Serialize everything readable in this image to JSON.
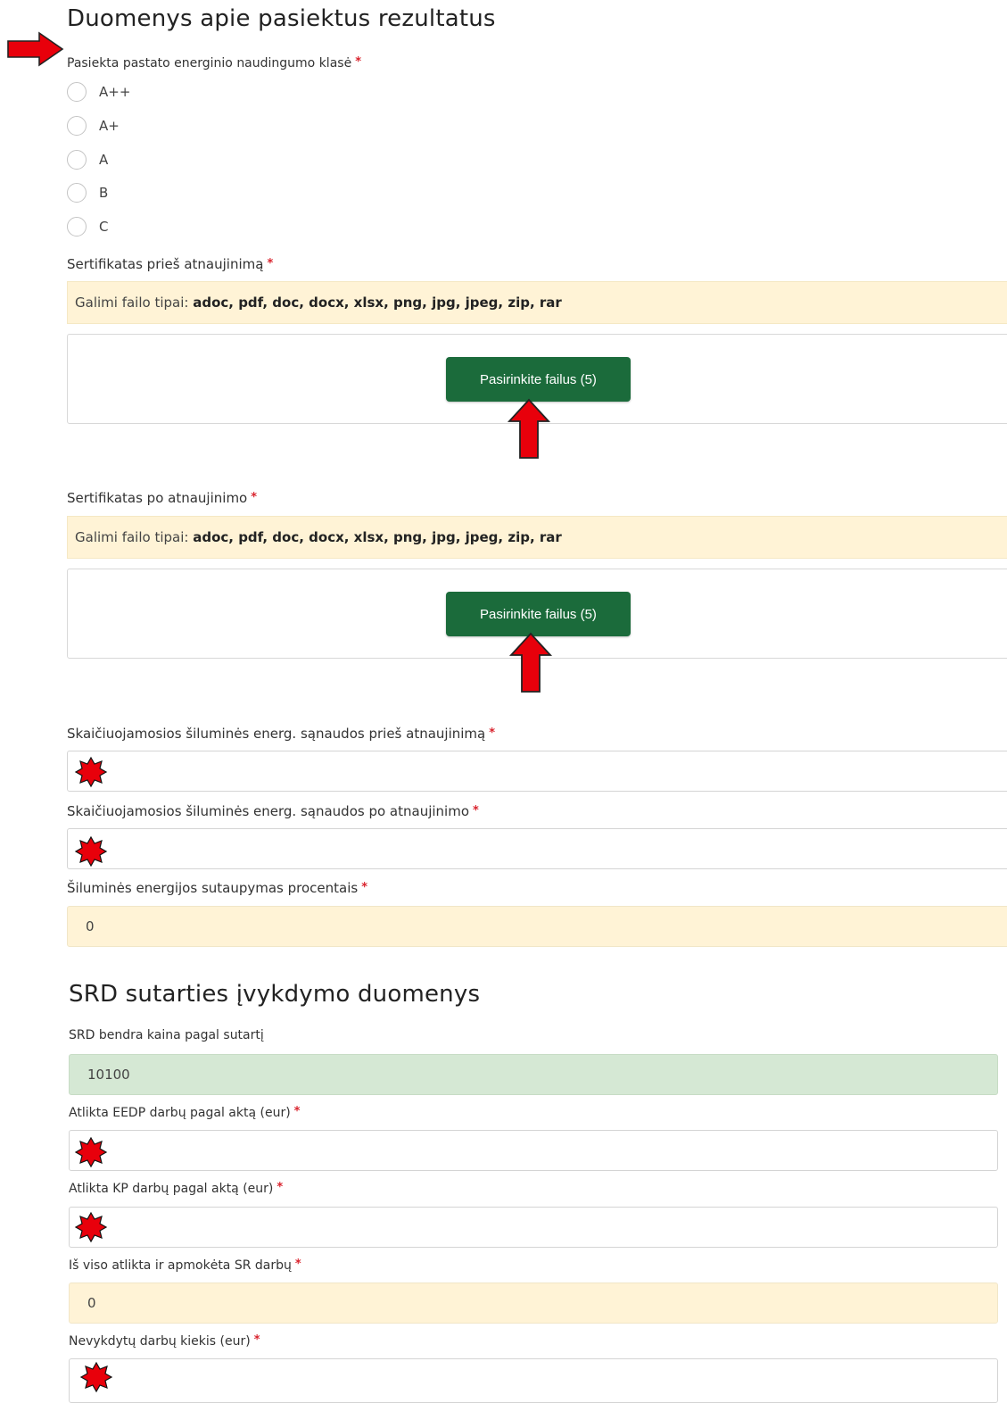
{
  "section1": {
    "title": "Duomenys apie pasiektus rezultatus",
    "class_label": "Pasiekta pastato energinio naudingumo klasė",
    "required_mark": "*",
    "class_options": [
      "A++",
      "A+",
      "A",
      "B",
      "C"
    ],
    "cert_before": {
      "label": "Sertifikatas prieš atnaujinimą",
      "info_prefix": "Galimi failo tipai:",
      "info_types": "adoc, pdf, doc, docx, xlsx, png, jpg, jpeg, zip, rar",
      "button": "Pasirinkite failus (5)"
    },
    "cert_after": {
      "label": "Sertifikatas po atnaujinimo",
      "info_prefix": "Galimi failo tipai:",
      "info_types": "adoc, pdf, doc, docx, xlsx, png, jpg, jpeg, zip, rar",
      "button": "Pasirinkite failus (5)"
    },
    "heat_before_label": "Skaičiuojamosios šiluminės energ. sąnaudos prieš atnaujinimą",
    "heat_before_value": "",
    "heat_after_label": "Skaičiuojamosios šiluminės energ. sąnaudos po atnaujinimo",
    "heat_after_value": "",
    "savings_label": "Šiluminės energijos sutaupymas procentais",
    "savings_value": "0"
  },
  "section2": {
    "title": "SRD sutarties įvykdymo duomenys",
    "total_price_label": "SRD bendra kaina pagal sutartį",
    "total_price_value": "10100",
    "eedp_label": "Atlikta EEDP darbų pagal aktą (eur)",
    "eedp_value": "",
    "kp_label": "Atlikta KP darbų pagal aktą (eur)",
    "kp_value": "",
    "total_done_label": "Iš viso atlikta ir apmokėta SR darbų",
    "total_done_value": "0",
    "undone_label": "Nevykdytų darbų kiekis (eur)",
    "undone_value": ""
  },
  "colors": {
    "button_green": "#1b6b3b",
    "info_yellow": "#fff3d6",
    "input_green": "#d5e8d4",
    "required_red": "#d9232d",
    "annotation_red": "#e8000b"
  },
  "annotations": {
    "arrow_icon": "red-arrow-icon",
    "star_icon": "red-star-icon"
  }
}
